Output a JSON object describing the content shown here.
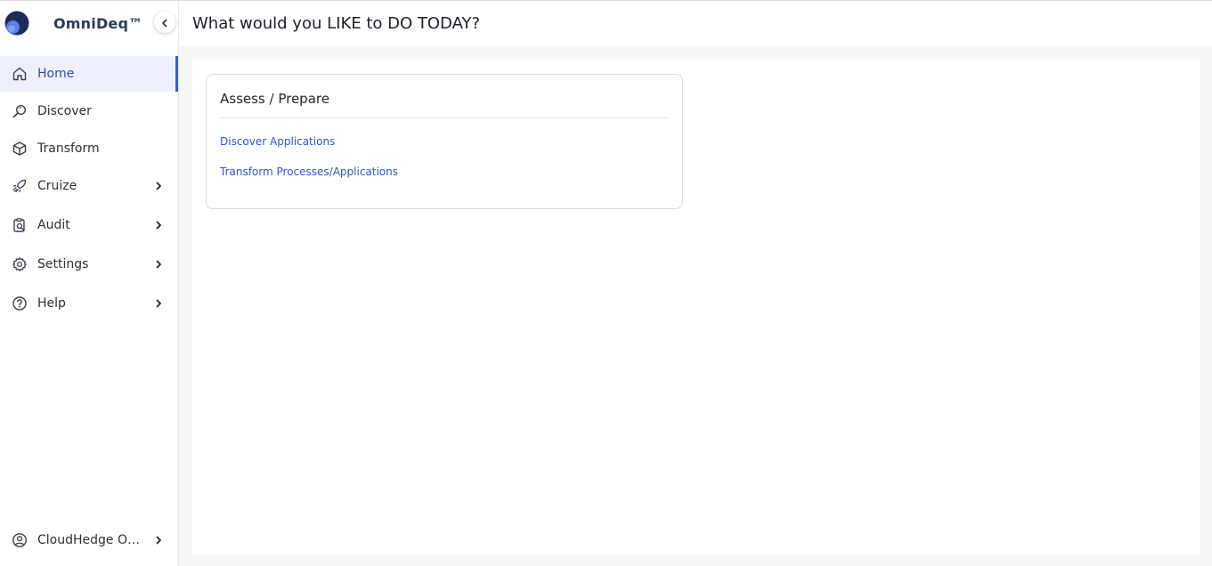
{
  "brand": {
    "name": "OmniDeq™"
  },
  "sidebar": {
    "items": [
      {
        "label": "Home",
        "icon": "home-icon"
      },
      {
        "label": "Discover",
        "icon": "search-icon"
      },
      {
        "label": "Transform",
        "icon": "cube-icon"
      },
      {
        "label": "Cruize",
        "icon": "rocket-icon"
      },
      {
        "label": "Audit",
        "icon": "audit-icon"
      },
      {
        "label": "Settings",
        "icon": "gear-icon"
      },
      {
        "label": "Help",
        "icon": "help-icon"
      }
    ],
    "footer": {
      "label": "CloudHedge OnP...",
      "icon": "user-icon"
    }
  },
  "header": {
    "title": "What would you LIKE to DO TODAY?"
  },
  "card": {
    "title": "Assess / Prepare",
    "links": [
      "Discover Applications",
      "Transform Processes/Applications"
    ]
  },
  "colors": {
    "accent": "#3a5bd9",
    "link": "#3253c8",
    "active_bg": "#eef1fc"
  }
}
